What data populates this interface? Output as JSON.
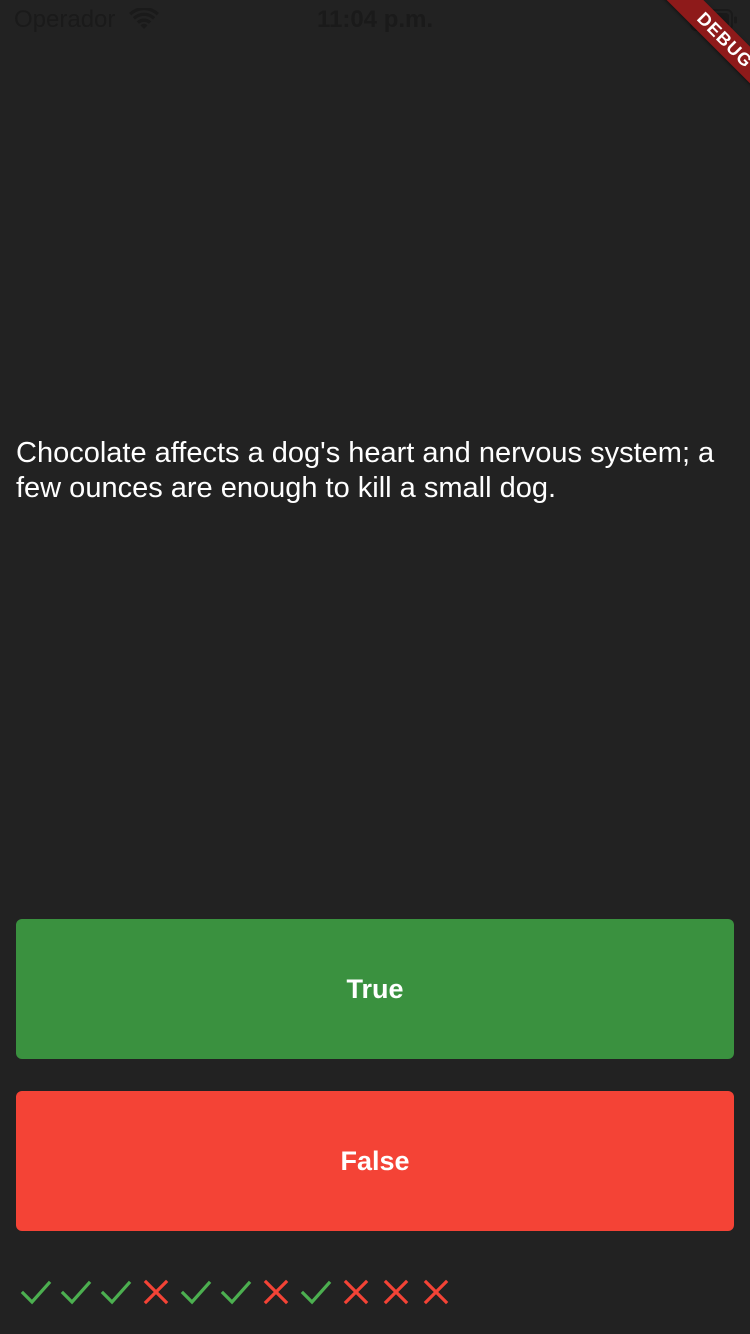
{
  "status_bar": {
    "carrier": "Operador",
    "time": "11:04 p.m.",
    "icons": [
      "wifi-icon",
      "battery-icon"
    ]
  },
  "debug_banner": {
    "label": "DEBUG",
    "color": "#8e1a1a"
  },
  "question": {
    "text": "Chocolate affects a dog's heart and nervous system; a few ounces are enough to kill a small dog."
  },
  "buttons": {
    "true_label": "True",
    "true_color": "#3a913f",
    "false_label": "False",
    "false_color": "#f44336"
  },
  "score_keeper": [
    {
      "result": "correct",
      "icon": "check-icon"
    },
    {
      "result": "correct",
      "icon": "check-icon"
    },
    {
      "result": "correct",
      "icon": "check-icon"
    },
    {
      "result": "wrong",
      "icon": "close-icon"
    },
    {
      "result": "correct",
      "icon": "check-icon"
    },
    {
      "result": "correct",
      "icon": "check-icon"
    },
    {
      "result": "wrong",
      "icon": "close-icon"
    },
    {
      "result": "correct",
      "icon": "check-icon"
    },
    {
      "result": "wrong",
      "icon": "close-icon"
    },
    {
      "result": "wrong",
      "icon": "close-icon"
    },
    {
      "result": "wrong",
      "icon": "close-icon"
    }
  ],
  "colors": {
    "background": "#222222",
    "correct": "#4caf50",
    "wrong": "#f44336"
  }
}
